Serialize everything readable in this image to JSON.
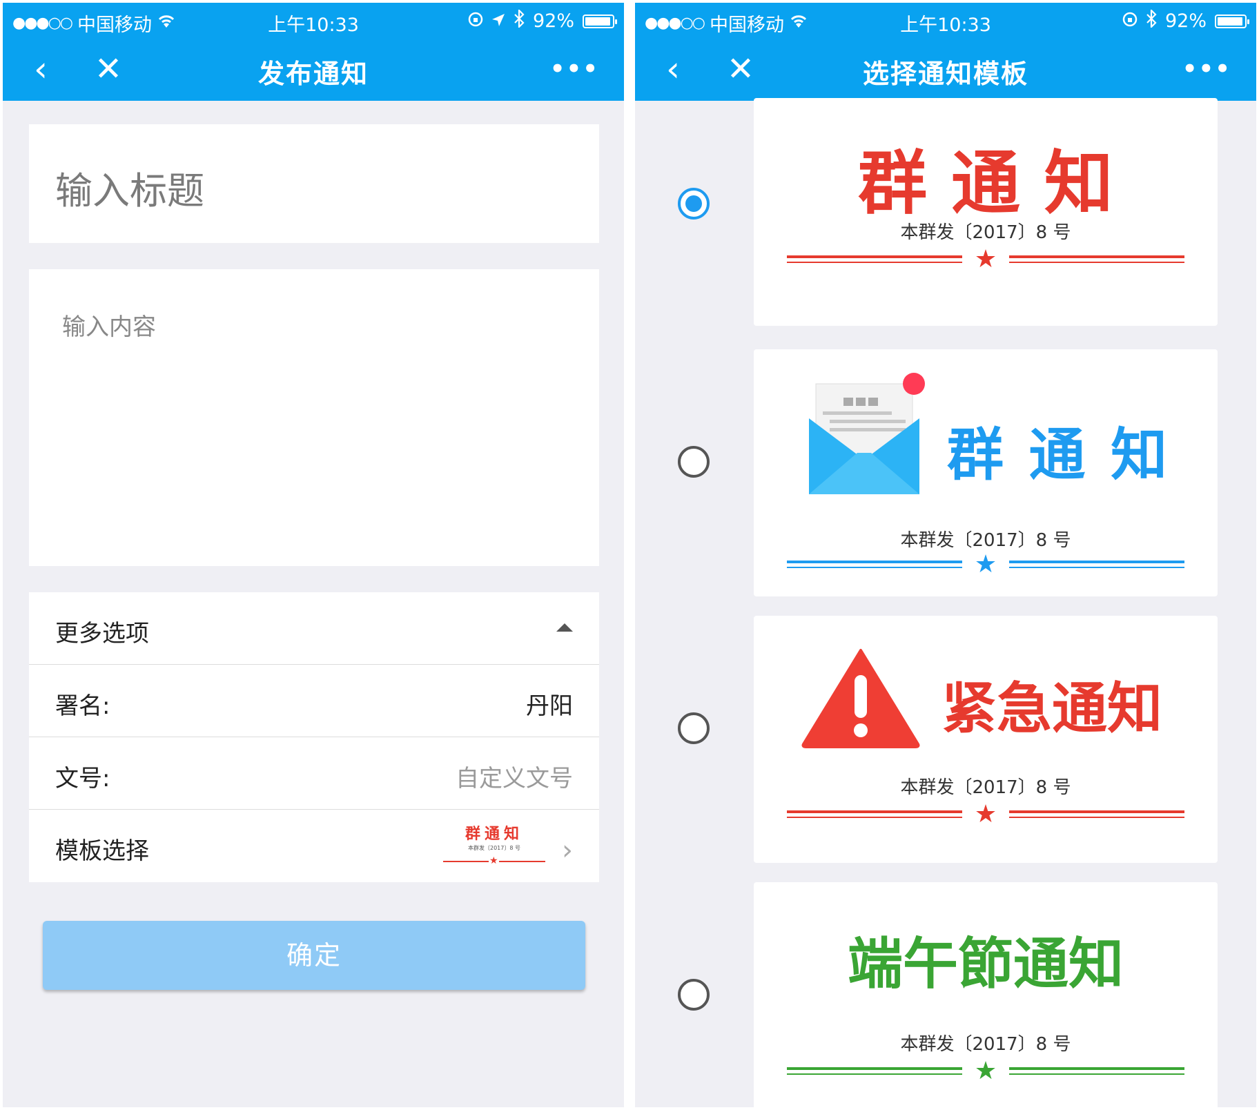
{
  "colors": {
    "brand": "#09a2f0",
    "bg": "#efeff4",
    "red": "#e63a2e",
    "blue": "#1e9bf0",
    "green": "#3aa534",
    "button": "#8fcaf6"
  },
  "statusbar": {
    "carrier": "中国移动",
    "time": "上午10:33",
    "battery": "92%"
  },
  "left": {
    "nav": {
      "back_icon": "chevron-left-icon",
      "close_icon": "close-icon",
      "title": "发布通知",
      "more_icon": "more-icon"
    },
    "title_placeholder": "输入标题",
    "content_placeholder": "输入内容",
    "options": {
      "header": "更多选项",
      "signature_label": "署名:",
      "signature_value": "丹阳",
      "docno_label": "文号:",
      "docno_placeholder": "自定义文号",
      "template_label": "模板选择",
      "template_preview_title": "群通知",
      "template_preview_sub": "本群发〔2017〕8 号"
    },
    "confirm_label": "确定"
  },
  "right": {
    "nav": {
      "title": "选择通知模板"
    },
    "templates": [
      {
        "title": "群 通 知",
        "sub": "本群发〔2017〕8 号",
        "color": "#e63a2e",
        "selected": true
      },
      {
        "title": "群 通 知",
        "sub": "本群发〔2017〕8 号",
        "color": "#1e9bf0",
        "selected": false,
        "icon": "envelope-icon"
      },
      {
        "title": "紧急通知",
        "sub": "本群发〔2017〕8 号",
        "color": "#e63a2e",
        "selected": false,
        "icon": "warning-icon"
      },
      {
        "title": "端午節通知",
        "sub": "本群发〔2017〕8 号",
        "color": "#3aa534",
        "selected": false
      }
    ]
  }
}
